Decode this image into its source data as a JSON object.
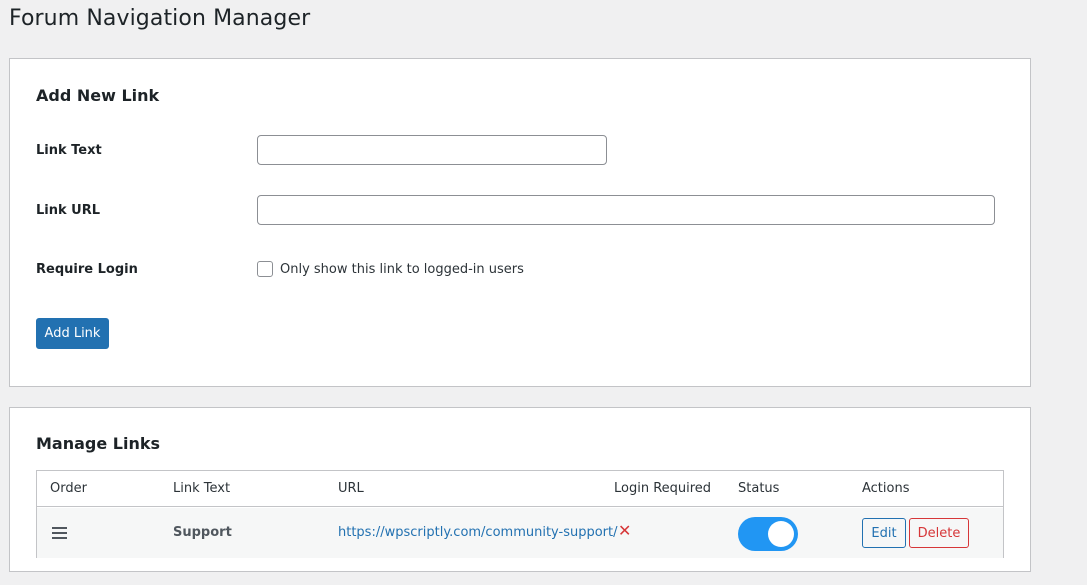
{
  "page": {
    "title": "Forum Navigation Manager"
  },
  "add_form": {
    "heading": "Add New Link",
    "link_text_label": "Link Text",
    "link_text_value": "",
    "link_url_label": "Link URL",
    "link_url_value": "",
    "require_login_label": "Require Login",
    "require_login_checkbox_label": "Only show this link to logged-in users",
    "require_login_checked": false,
    "submit_label": "Add Link"
  },
  "manage": {
    "heading": "Manage Links",
    "columns": [
      "Order",
      "Link Text",
      "URL",
      "Login Required",
      "Status",
      "Actions"
    ],
    "rows": [
      {
        "order_icon": "drag-handle-icon",
        "link_text": "Support",
        "url": "https://wpscriptly.com/community-support/",
        "login_required_icon": "x-icon",
        "login_required": false,
        "status_enabled": true,
        "edit_label": "Edit",
        "delete_label": "Delete"
      }
    ]
  },
  "colors": {
    "primary": "#2271b1",
    "danger": "#d63638",
    "toggle_on": "#2196f3",
    "background": "#f0f0f1"
  }
}
